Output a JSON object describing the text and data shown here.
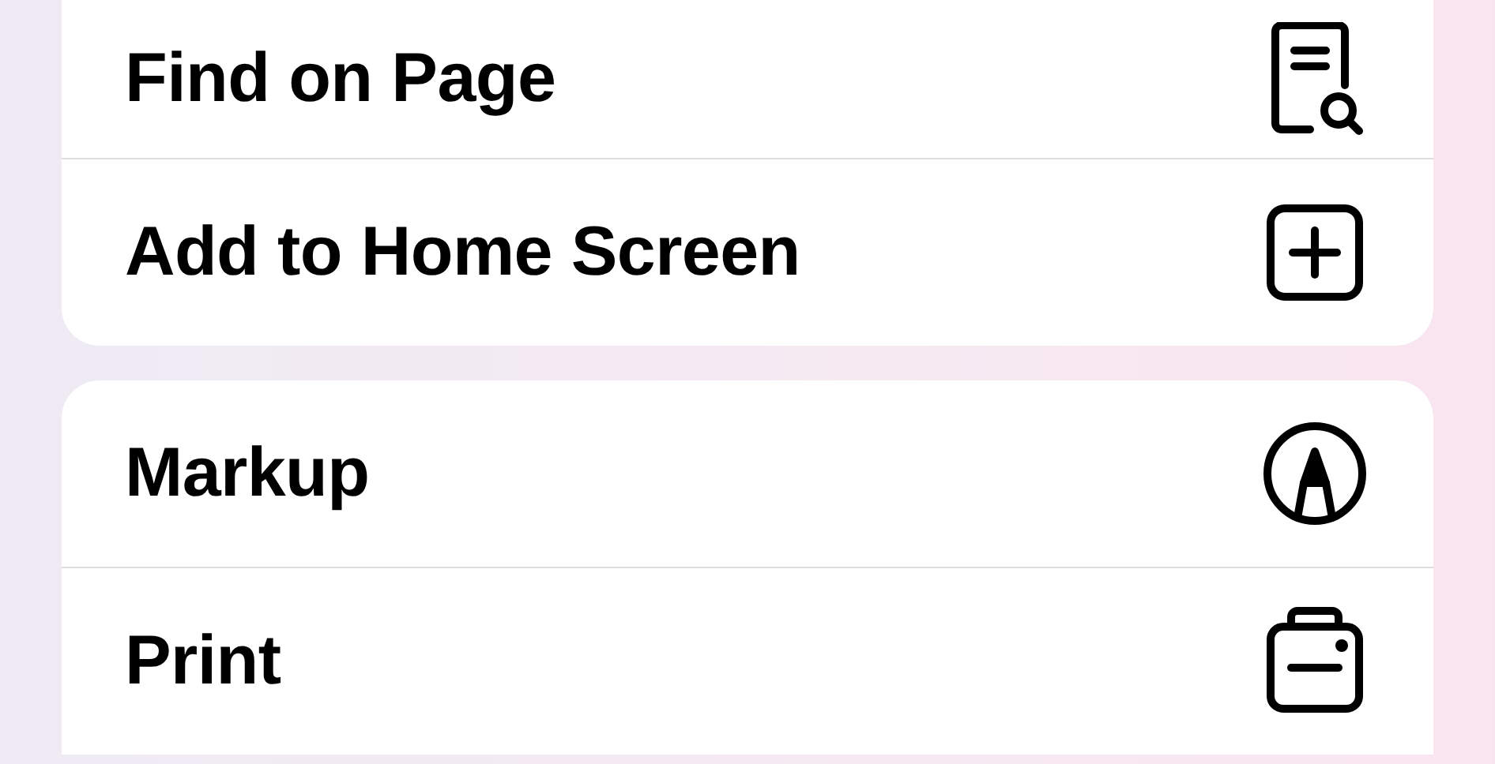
{
  "groups": [
    {
      "items": [
        {
          "label": "Find on Page",
          "kind": "find"
        },
        {
          "label": "Add to Home Screen",
          "kind": "add"
        }
      ]
    },
    {
      "items": [
        {
          "label": "Markup",
          "kind": "markup"
        },
        {
          "label": "Print",
          "kind": "print"
        }
      ]
    }
  ]
}
